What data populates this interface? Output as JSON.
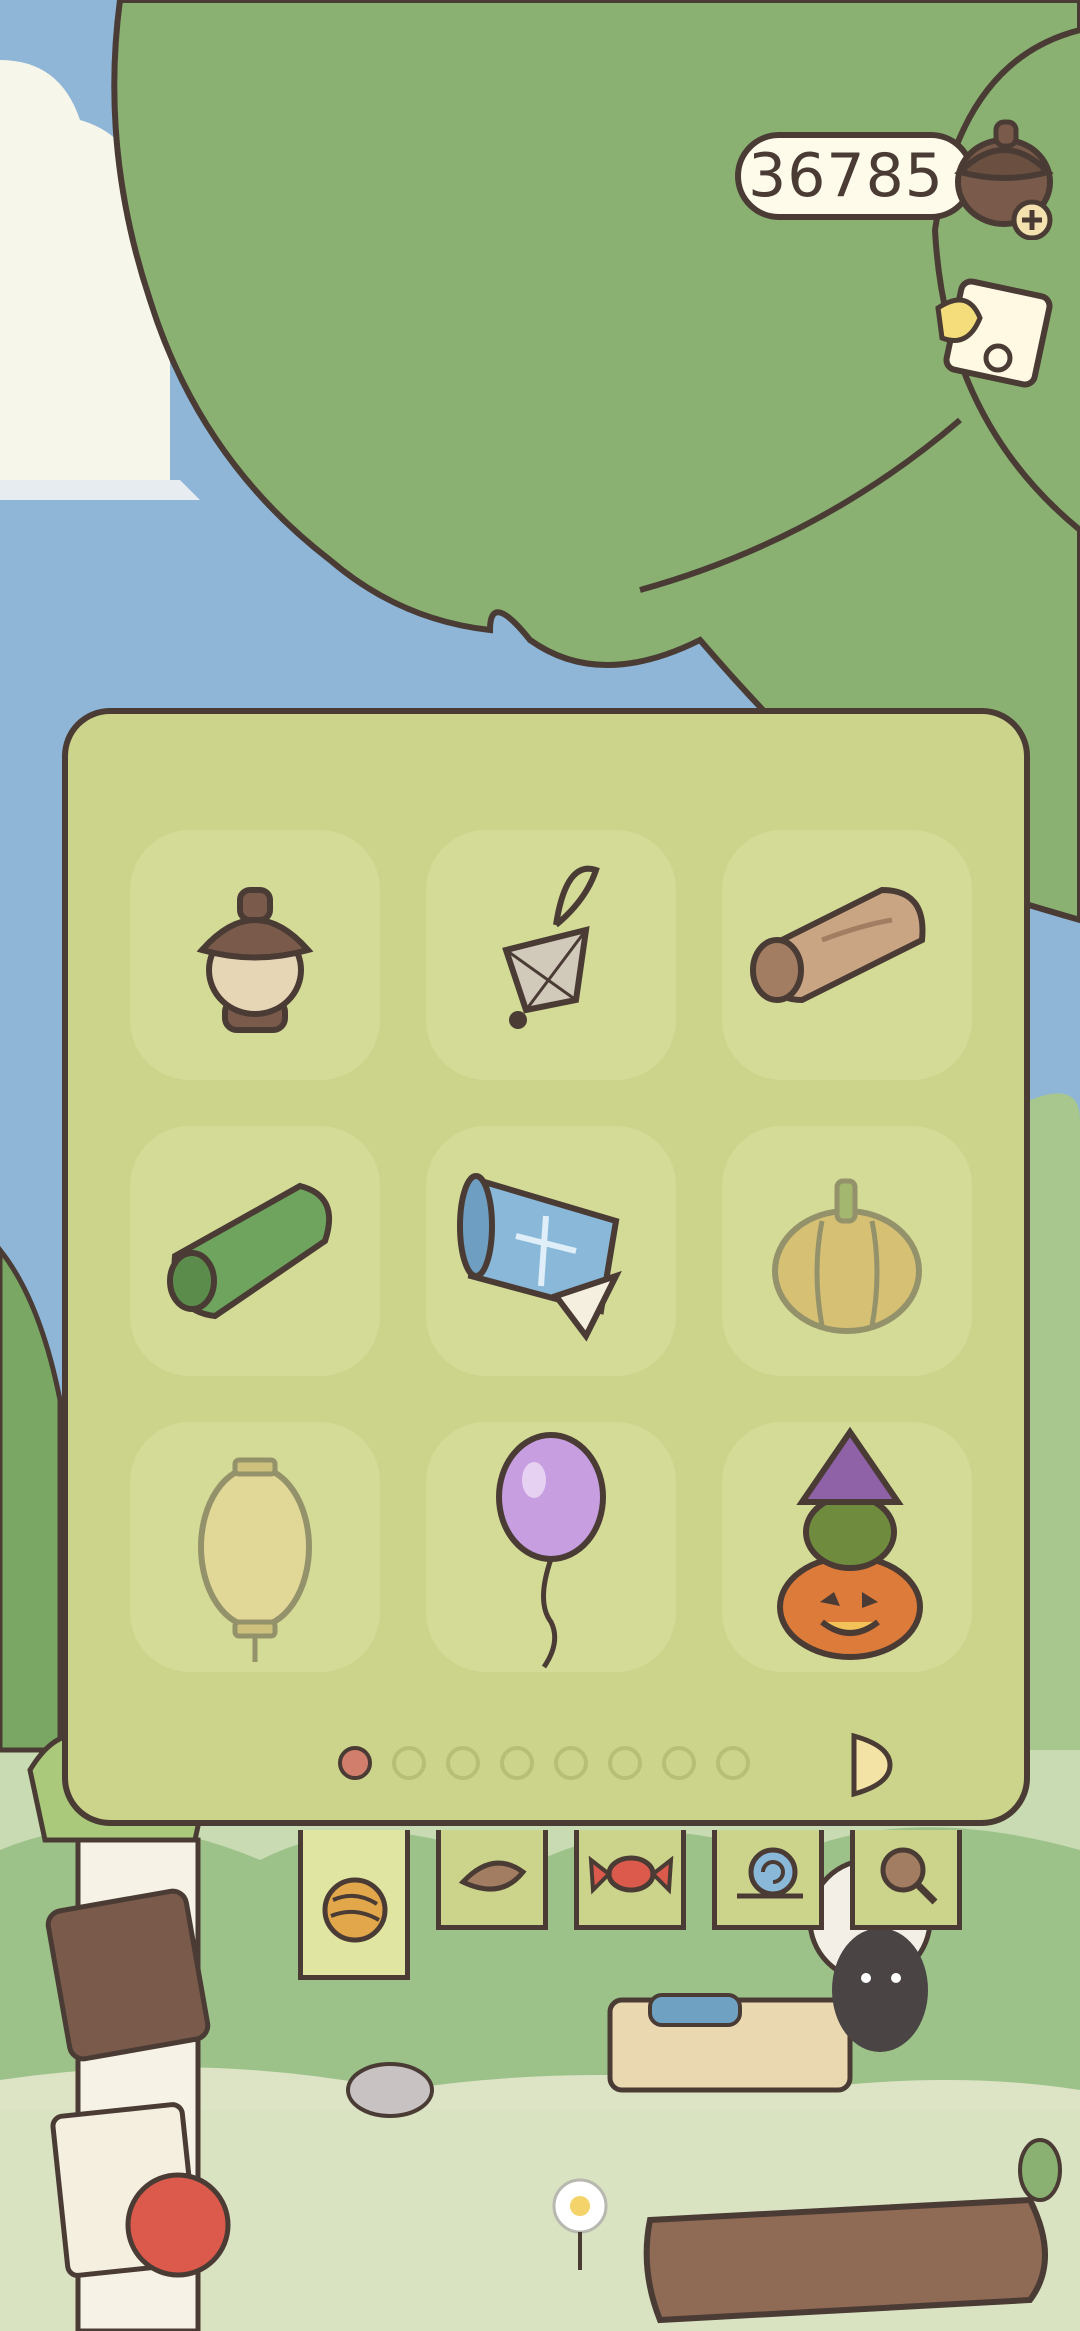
{
  "hud": {
    "currency_value": "36785",
    "currency_icon": "acorn-icon",
    "add_icon": "plus-icon",
    "notes_icon": "notes-icon"
  },
  "inventory": {
    "items": [
      {
        "icon": "acorn-icon",
        "available": true
      },
      {
        "icon": "spiderweb-charm-icon",
        "available": true
      },
      {
        "icon": "wood-log-scroll-icon",
        "available": true
      },
      {
        "icon": "leaf-wrap-icon",
        "available": true
      },
      {
        "icon": "blueprint-scroll-icon",
        "available": true
      },
      {
        "icon": "pumpkin-icon",
        "available": false
      },
      {
        "icon": "paper-lantern-icon",
        "available": false
      },
      {
        "icon": "purple-balloon-icon",
        "available": true
      },
      {
        "icon": "jack-o-lantern-stack-icon",
        "available": true
      }
    ],
    "pager": {
      "total_pages": 8,
      "current_page": 1,
      "next_icon": "next-page-icon"
    }
  },
  "tabs": [
    {
      "icon": "yarn-ball-icon",
      "active": true
    },
    {
      "icon": "leaf-icon",
      "active": false
    },
    {
      "icon": "candy-icon",
      "active": false
    },
    {
      "icon": "snail-icon",
      "active": false
    },
    {
      "icon": "magnifier-icon",
      "active": false
    }
  ],
  "colors": {
    "panel": "#cbd48a",
    "outline": "#4a3c35",
    "active_dot": "#d27e6c",
    "sky": "#8fb6d6",
    "tree": "#8ab172"
  }
}
